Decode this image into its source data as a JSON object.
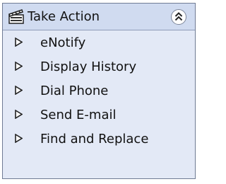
{
  "panel": {
    "title": "Take Action",
    "header_icon": "action-clapperboard-icon",
    "collapse_icon": "chevron-double-up-icon"
  },
  "items": [
    {
      "label": "eNotify",
      "icon": "triangle-right-icon"
    },
    {
      "label": "Display History",
      "icon": "triangle-right-icon"
    },
    {
      "label": "Dial Phone",
      "icon": "triangle-right-icon"
    },
    {
      "label": "Send E-mail",
      "icon": "triangle-right-icon"
    },
    {
      "label": "Find and Replace",
      "icon": "triangle-right-icon"
    }
  ],
  "colors": {
    "panel_bg": "#e3e9f6",
    "header_bg": "#d0dbf0",
    "border": "#6f7b94"
  }
}
